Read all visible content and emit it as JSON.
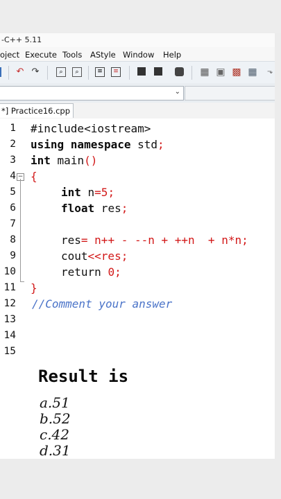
{
  "window": {
    "title": "-C++ 5.11"
  },
  "menu": [
    "oject",
    "Execute",
    "Tools",
    "AStyle",
    "Window",
    "Help"
  ],
  "toolbar_icons": [
    "undo-icon",
    "redo-icon",
    "find-icon",
    "replace-icon",
    "compile-icon",
    "run-icon",
    "compile-run-icon",
    "rebuild-icon",
    "debug-icon",
    "grid-icon",
    "window-icon",
    "chart-icon",
    "layout-icon",
    "more-icon"
  ],
  "file_tab": "*] Practice16.cpp",
  "line_numbers": [
    "1",
    "2",
    "3",
    "4",
    "5",
    "6",
    "7",
    "8",
    "9",
    "10",
    "11",
    "12",
    "13",
    "14",
    "15"
  ],
  "code": {
    "l1": "#include<iostream>",
    "l2a": "using namespace",
    "l2b": " std",
    "l2c": ";",
    "l3a": "int",
    "l3b": " main",
    "l3c": "()",
    "l4": "{",
    "l5a": "int",
    "l5b": " n",
    "l5c": "=5;",
    "l6a": "float",
    "l6b": " res",
    "l6c": ";",
    "l8a": "res",
    "l8b": "= n++ - --n + ++n  + n*n;",
    "l9a": "cout",
    "l9b": "<<res;",
    "l10a": "return ",
    "l10b": "0;",
    "l11": "}",
    "l12": "//Comment your answer"
  },
  "question": "Result is",
  "options": [
    "a.51",
    "b.52",
    "c.42",
    "d.31"
  ],
  "colors": {
    "keyword": "#0b0b0b",
    "operator": "#d21818",
    "comment": "#4a73c8",
    "window": "#ffffff",
    "toolbar": "#eef2f6"
  }
}
